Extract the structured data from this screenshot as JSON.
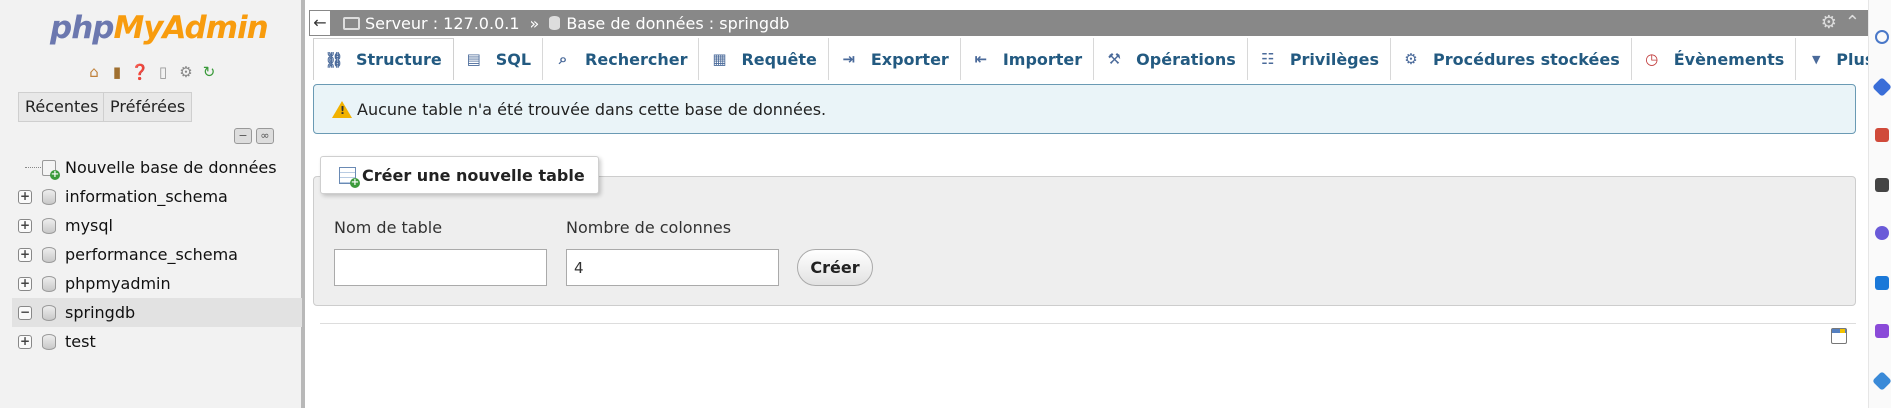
{
  "logo": {
    "part1": "php",
    "part2": "MyAdmin"
  },
  "left": {
    "recent_label": "Récentes",
    "favorites_label": "Préférées",
    "tree": [
      {
        "label": "Nouvelle base de données",
        "kind": "new"
      },
      {
        "label": "information_schema",
        "kind": "db",
        "toggle": "+"
      },
      {
        "label": "mysql",
        "kind": "db",
        "toggle": "+"
      },
      {
        "label": "performance_schema",
        "kind": "db",
        "toggle": "+"
      },
      {
        "label": "phpmyadmin",
        "kind": "db",
        "toggle": "+"
      },
      {
        "label": "springdb",
        "kind": "db",
        "toggle": "−",
        "selected": true
      },
      {
        "label": "test",
        "kind": "db",
        "toggle": "+"
      }
    ]
  },
  "breadcrumb": {
    "back": "←",
    "server": "Serveur : 127.0.0.1",
    "separator": "»",
    "database": "Base de données : springdb"
  },
  "tabs": [
    {
      "label": "Structure",
      "icon": "structure-icon",
      "glyph": "⛓",
      "active": true
    },
    {
      "label": "SQL",
      "icon": "sql-icon",
      "glyph": "▤"
    },
    {
      "label": "Rechercher",
      "icon": "search-icon",
      "glyph": "⌕"
    },
    {
      "label": "Requête",
      "icon": "query-icon",
      "glyph": "▦"
    },
    {
      "label": "Exporter",
      "icon": "export-icon",
      "glyph": "⇥"
    },
    {
      "label": "Importer",
      "icon": "import-icon",
      "glyph": "⇤"
    },
    {
      "label": "Opérations",
      "icon": "wrench-icon",
      "glyph": "⚒"
    },
    {
      "label": "Privilèges",
      "icon": "privileges-icon",
      "glyph": "☷"
    },
    {
      "label": "Procédures stockées",
      "icon": "routines-icon",
      "glyph": "⚙"
    },
    {
      "label": "Évènements",
      "icon": "events-icon",
      "glyph": "◷"
    },
    {
      "label": "Plus",
      "icon": "more-icon",
      "glyph": "▼"
    }
  ],
  "notice": {
    "text": "Aucune table n'a été trouvée dans cette base de données."
  },
  "create_table": {
    "legend": "Créer une nouvelle table",
    "name_label": "Nom de table",
    "name_value": "",
    "columns_label": "Nombre de colonnes",
    "columns_value": "4",
    "button": "Créer"
  },
  "colors": {
    "accent": "#235a81",
    "topbar": "#888888",
    "notice_bg": "#eaf4f8",
    "logo_php": "#6c78af",
    "logo_myadmin": "#f89c0e"
  }
}
